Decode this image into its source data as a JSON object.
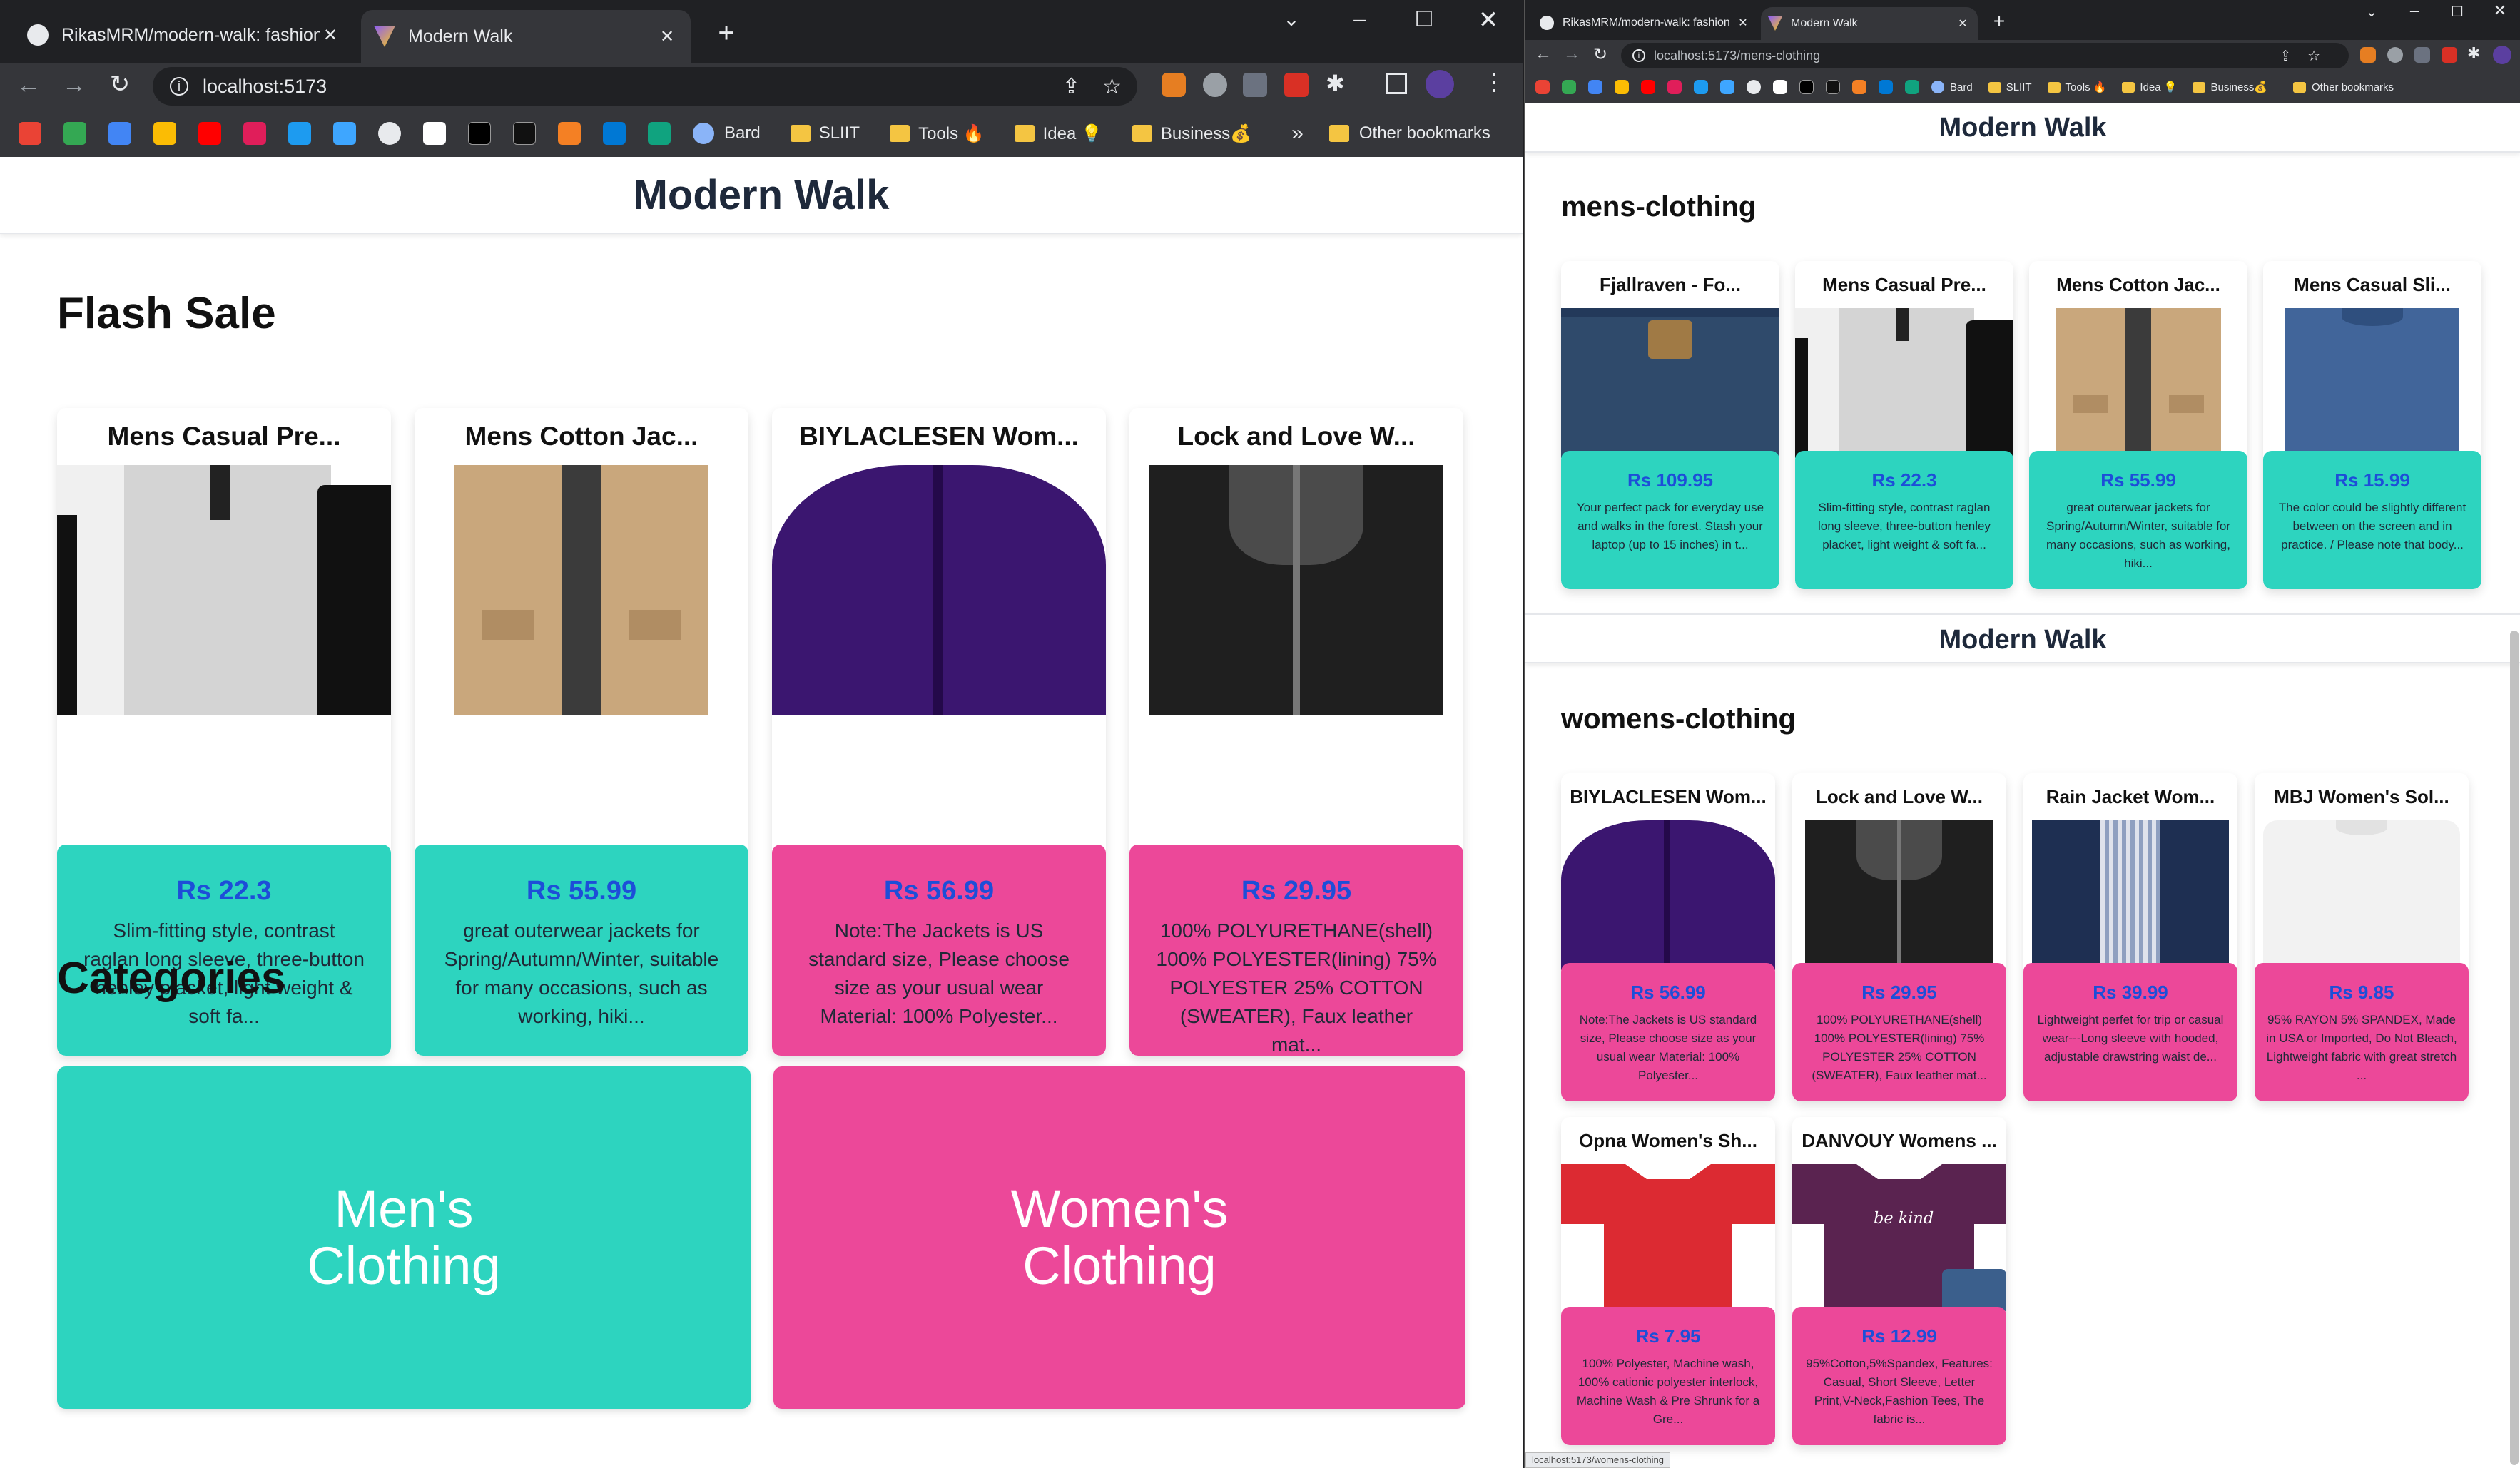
{
  "left": {
    "tabs": [
      {
        "title": "RikasMRM/modern-walk: fashion",
        "active": false,
        "icon": "github-icon"
      },
      {
        "title": "Modern Walk",
        "active": true,
        "icon": "vite-icon"
      }
    ],
    "url": "localhost:5173",
    "site_title": "Modern Walk",
    "flash_sale_heading": "Flash Sale",
    "categories_heading": "Categories",
    "flash_items": [
      {
        "title": "Mens Casual Pre...",
        "price": "Rs 22.3",
        "desc": "Slim-fitting style, contrast raglan long sleeve, three-button henley placket, light weight & soft fa...",
        "color": "#2dd4bf"
      },
      {
        "title": "Mens Cotton Jac...",
        "price": "Rs 55.99",
        "desc": "great outerwear jackets for Spring/Autumn/Winter, suitable for many occasions, such as working, hiki...",
        "color": "#2dd4bf"
      },
      {
        "title": "BIYLACLESEN Wom...",
        "price": "Rs 56.99",
        "desc": "Note:The Jackets is US standard size, Please choose size as your usual wear Material: 100% Polyester...",
        "color": "#ec4899"
      },
      {
        "title": "Lock and Love W...",
        "price": "Rs 29.95",
        "desc": "100% POLYURETHANE(shell) 100% POLYESTER(lining) 75% POLYESTER 25% COTTON (SWEATER), Faux leather mat...",
        "color": "#ec4899"
      }
    ],
    "categories": [
      {
        "label": "Men's Clothing",
        "color": "#2dd4bf"
      },
      {
        "label": "Women's Clothing",
        "color": "#ec4899"
      }
    ]
  },
  "right": {
    "tabs": [
      {
        "title": "RikasMRM/modern-walk: fashion",
        "active": false,
        "icon": "github-icon"
      },
      {
        "title": "Modern Walk",
        "active": true,
        "icon": "vite-icon"
      }
    ],
    "url": "localhost:5173/mens-clothing",
    "site_title": "Modern Walk",
    "mens_heading": "mens-clothing",
    "womens_heading": "womens-clothing",
    "mens_items": [
      {
        "title": "Fjallraven - Fo...",
        "price": "Rs 109.95",
        "desc": "Your perfect pack for everyday use and walks in the forest. Stash your laptop (up to 15 inches) in t..."
      },
      {
        "title": "Mens Casual Pre...",
        "price": "Rs 22.3",
        "desc": "Slim-fitting style, contrast raglan long sleeve, three-button henley placket, light weight & soft fa..."
      },
      {
        "title": "Mens Cotton Jac...",
        "price": "Rs 55.99",
        "desc": "great outerwear jackets for Spring/Autumn/Winter, suitable for many occasions, such as working, hiki..."
      },
      {
        "title": "Mens Casual Sli...",
        "price": "Rs 15.99",
        "desc": "The color could be slightly different between on the screen and in practice. / Please note that body..."
      }
    ],
    "womens_items": [
      {
        "title": "BIYLACLESEN Wom...",
        "price": "Rs 56.99",
        "desc": "Note:The Jackets is US standard size, Please choose size as your usual wear Material: 100% Polyester..."
      },
      {
        "title": "Lock and Love W...",
        "price": "Rs 29.95",
        "desc": "100% POLYURETHANE(shell) 100% POLYESTER(lining) 75% POLYESTER 25% COTTON (SWEATER), Faux leather mat..."
      },
      {
        "title": "Rain Jacket Wom...",
        "price": "Rs 39.99",
        "desc": "Lightweight perfet for trip or casual wear---Long sleeve with hooded, adjustable drawstring waist de..."
      },
      {
        "title": "MBJ Women's Sol...",
        "price": "Rs 9.85",
        "desc": "95% RAYON 5% SPANDEX, Made in USA or Imported, Do Not Bleach, Lightweight fabric with great stretch ..."
      },
      {
        "title": "Opna Women's Sh...",
        "price": "Rs 7.95",
        "desc": "100% Polyester, Machine wash, 100% cationic polyester interlock, Machine Wash & Pre Shrunk for a Gre..."
      },
      {
        "title": "DANVOUY Womens ...",
        "price": "Rs 12.99",
        "desc": "95%Cotton,5%Spandex, Features: Casual, Short Sleeve, Letter Print,V-Neck,Fashion Tees, The fabric is..."
      }
    ],
    "status_url": "localhost:5173/womens-clothing"
  },
  "bookmarks": [
    "Bard",
    "SLIIT",
    "Tools 🔥",
    "Idea 💡",
    "Business💰"
  ],
  "other_bookmarks": "Other bookmarks",
  "more_bookmarks": "»",
  "tab_close": "✕",
  "new_tab": "+"
}
